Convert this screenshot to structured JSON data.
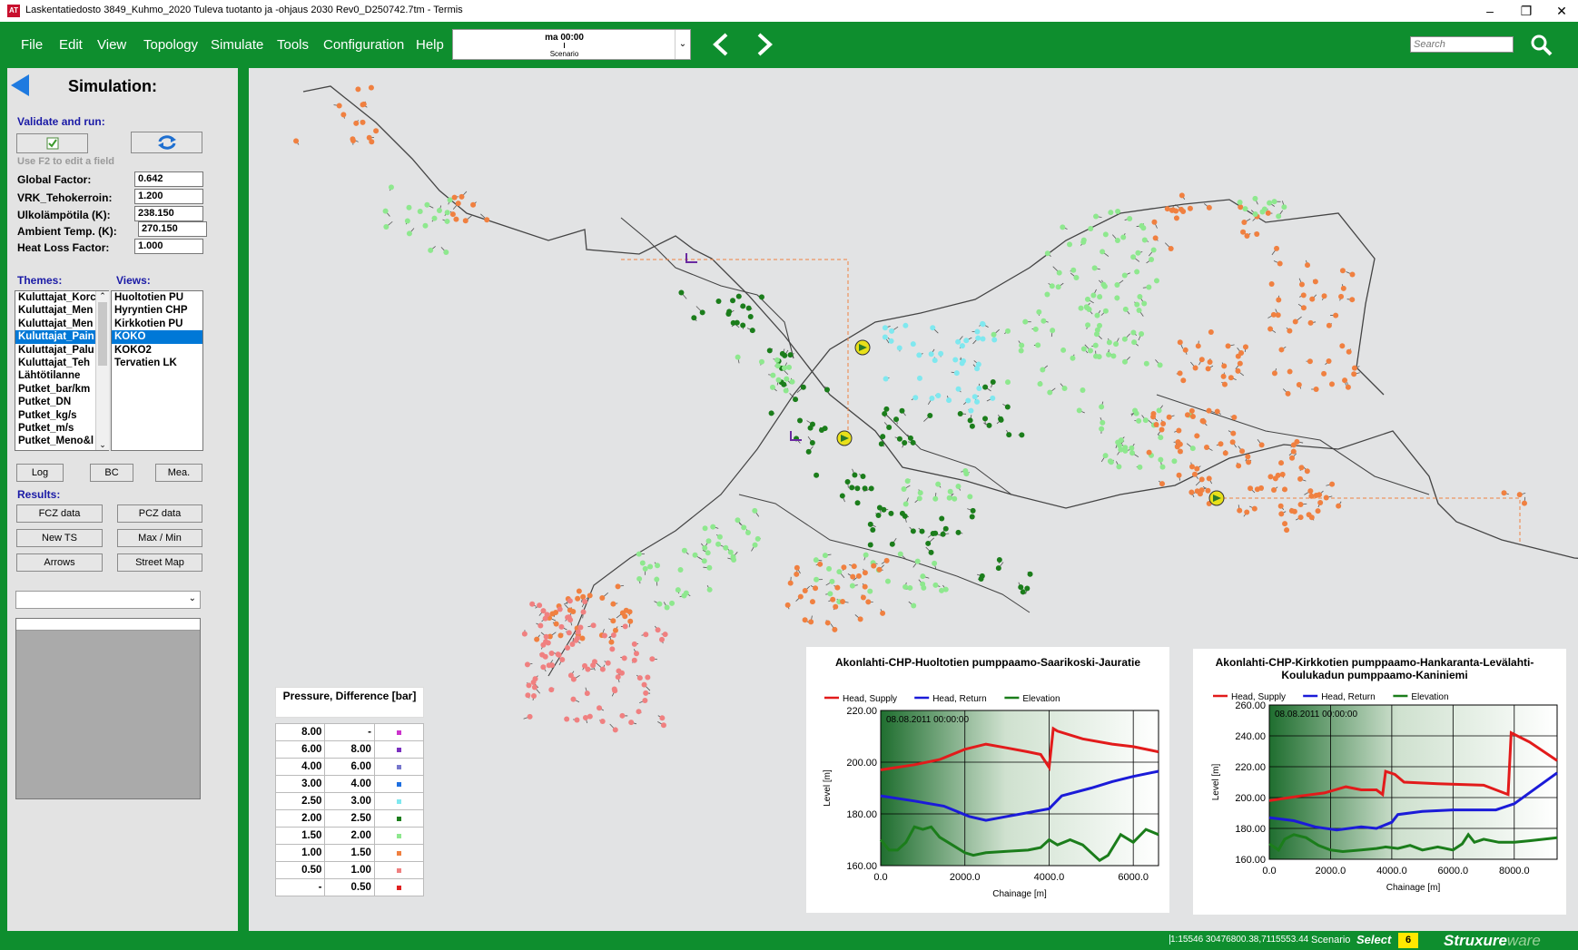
{
  "window": {
    "title": "Laskentatiedosto 3849_Kuhmo_2020 Tuleva tuotanto ja -ohjaus 2030 Rev0_D250742.7tm - Termis",
    "app_icon": "AT",
    "minimize": "–",
    "restore": "❐",
    "close": "✕"
  },
  "menu": {
    "items": [
      "File",
      "Edit",
      "View",
      "Topology",
      "Simulate",
      "Tools",
      "Configuration",
      "Help"
    ],
    "scenario_time": "ma 00:00",
    "scenario_label": "Scenario",
    "search_placeholder": "Search"
  },
  "panel": {
    "title": "Simulation:",
    "validate_label": "Validate and run:",
    "f2_hint": "Use F2 to edit a field",
    "fields": [
      {
        "label": "Global Factor:",
        "value": "0.642"
      },
      {
        "label": "VRK_Tehokerroin:",
        "value": "1.200"
      },
      {
        "label": "Ulkolämpötila (K):",
        "value": "238.150"
      },
      {
        "label": "Ambient Temp. (K):",
        "value": "270.150"
      },
      {
        "label": "Heat Loss Factor:",
        "value": "1.000"
      }
    ],
    "themes_label": "Themes:",
    "views_label": "Views:",
    "themes": [
      "Kuluttajat_Korc",
      "Kuluttajat_Men",
      "Kuluttajat_Men",
      "Kuluttajat_Pain",
      "Kuluttajat_Palu",
      "Kuluttajat_Teh",
      "Lähtötilanne",
      "Putket_bar/km",
      "Putket_DN",
      "Putket_kg/s",
      "Putket_m/s",
      "Putket_Meno&l"
    ],
    "themes_selected": 3,
    "views": [
      "Huoltotien PU",
      "Hyryntien CHP",
      "Kirkkotien PU",
      "KOKO",
      "KOKO2",
      "Tervatien LK"
    ],
    "views_selected": 3,
    "log_btn": "Log",
    "bc_btn": "BC",
    "mea_btn": "Mea.",
    "results_label": "Results:",
    "fcz_btn": "FCZ data",
    "pcz_btn": "PCZ data",
    "newts_btn": "New TS",
    "maxmin_btn": "Max / Min",
    "arrows_btn": "Arrows",
    "streetmap_btn": "Street Map"
  },
  "legend": {
    "title": "Pressure, Difference [bar]",
    "rows": [
      {
        "from": "8.00",
        "to": "-",
        "color": "#cc33cc"
      },
      {
        "from": "6.00",
        "to": "8.00",
        "color": "#7a2fbf"
      },
      {
        "from": "4.00",
        "to": "6.00",
        "color": "#7777cc"
      },
      {
        "from": "3.00",
        "to": "4.00",
        "color": "#1e6fe0"
      },
      {
        "from": "2.50",
        "to": "3.00",
        "color": "#7fe8ef"
      },
      {
        "from": "2.00",
        "to": "2.50",
        "color": "#1b7d1b"
      },
      {
        "from": "1.50",
        "to": "2.00",
        "color": "#8ee88e"
      },
      {
        "from": "1.00",
        "to": "1.50",
        "color": "#f08040"
      },
      {
        "from": "0.50",
        "to": "1.00",
        "color": "#f08080"
      },
      {
        "from": "-",
        "to": "0.50",
        "color": "#e02020"
      }
    ]
  },
  "chart_data": [
    {
      "type": "line",
      "title": "Akonlahti-CHP-Huoltotien  pumppaamo-Saarikoski-Jauratie",
      "timestamp": "08.08.2011 00:00:00",
      "xlabel": "Chainage [m]",
      "ylabel": "Level [m]",
      "xlim": [
        0,
        6600
      ],
      "ylim": [
        160,
        220
      ],
      "xticks": [
        "0.0",
        "2000.0",
        "4000.0",
        "6000.0"
      ],
      "yticks": [
        "160.00",
        "180.00",
        "200.00",
        "220.00"
      ],
      "legend": "top",
      "series": [
        {
          "name": "Head, Supply",
          "color": "#e21b1b",
          "x": [
            0,
            800,
            1400,
            2000,
            2500,
            3000,
            3500,
            3800,
            4000,
            4100,
            4200,
            4800,
            5500,
            6000,
            6600
          ],
          "y": [
            197,
            199,
            201,
            205,
            207,
            205.5,
            204,
            203,
            198,
            213,
            212,
            209,
            207,
            206,
            204
          ]
        },
        {
          "name": "Head, Return",
          "color": "#1b1bd8",
          "x": [
            0,
            800,
            1500,
            2100,
            2500,
            3000,
            3500,
            4000,
            4300,
            5000,
            5500,
            6000,
            6600
          ],
          "y": [
            187,
            185,
            183,
            179,
            177.5,
            179,
            180.5,
            182,
            187,
            190,
            192.5,
            194.5,
            196.5
          ]
        },
        {
          "name": "Elevation",
          "color": "#1b7d1b",
          "x": [
            0,
            200,
            400,
            600,
            800,
            1000,
            1200,
            1400,
            1700,
            2000,
            2200,
            2500,
            3000,
            3500,
            3800,
            4000,
            4200,
            4500,
            4800,
            5200,
            5400,
            5700,
            6000,
            6300,
            6600
          ],
          "y": [
            170,
            166,
            166,
            169,
            175,
            174,
            175,
            171,
            168,
            165,
            164,
            165,
            165.5,
            166,
            167,
            170,
            168,
            170,
            168,
            162,
            164,
            172,
            169,
            174,
            172
          ]
        }
      ]
    },
    {
      "type": "line",
      "title": "Akonlahti-CHP-Kirkkotien pumppaamo-Hankaranta-Levälahti-Koulukadun pumppaamo-Kaniniemi",
      "timestamp": "08.08.2011 00:00:00",
      "xlabel": "Chainage [m]",
      "ylabel": "Level [m]",
      "xlim": [
        0,
        9400
      ],
      "ylim": [
        160,
        260
      ],
      "xticks": [
        "0.0",
        "2000.0",
        "4000.0",
        "6000.0",
        "8000.0"
      ],
      "yticks": [
        "160.00",
        "180.00",
        "200.00",
        "220.00",
        "240.00",
        "260.00"
      ],
      "legend": "top",
      "series": [
        {
          "name": "Head, Supply",
          "color": "#e21b1b",
          "x": [
            0,
            1000,
            1800,
            2500,
            3000,
            3500,
            3700,
            3800,
            4100,
            4400,
            5500,
            7000,
            7800,
            7900,
            8500,
            9400
          ],
          "y": [
            198,
            201,
            203,
            207,
            205,
            205,
            202,
            217,
            215,
            210,
            209,
            208,
            202,
            242,
            236,
            224
          ]
        },
        {
          "name": "Head, Return",
          "color": "#1b1bd8",
          "x": [
            0,
            800,
            1500,
            2200,
            3000,
            3500,
            4000,
            4200,
            5000,
            6000,
            7000,
            7400,
            8000,
            9400
          ],
          "y": [
            187,
            185,
            181,
            179,
            181,
            180,
            184,
            189,
            191,
            192,
            192,
            192,
            196,
            216
          ]
        },
        {
          "name": "Elevation",
          "color": "#1b7d1b",
          "x": [
            0,
            300,
            500,
            800,
            1200,
            1600,
            2000,
            2400,
            3000,
            3500,
            3800,
            4200,
            4600,
            5000,
            5500,
            6000,
            6300,
            6500,
            6700,
            7000,
            7500,
            8000,
            8500,
            9400
          ],
          "y": [
            170,
            166,
            173,
            176,
            174,
            169,
            166,
            165,
            166,
            167,
            168,
            167,
            169,
            166,
            168,
            166,
            170,
            176,
            171,
            173,
            171,
            171,
            172,
            174
          ]
        }
      ]
    }
  ],
  "status": {
    "coords": "1:15546 30476800.38,7115553.44",
    "scenario": "Scenario",
    "select": "Select",
    "badge": "6",
    "brand": "Struxure",
    "brand_suffix": "ware"
  }
}
